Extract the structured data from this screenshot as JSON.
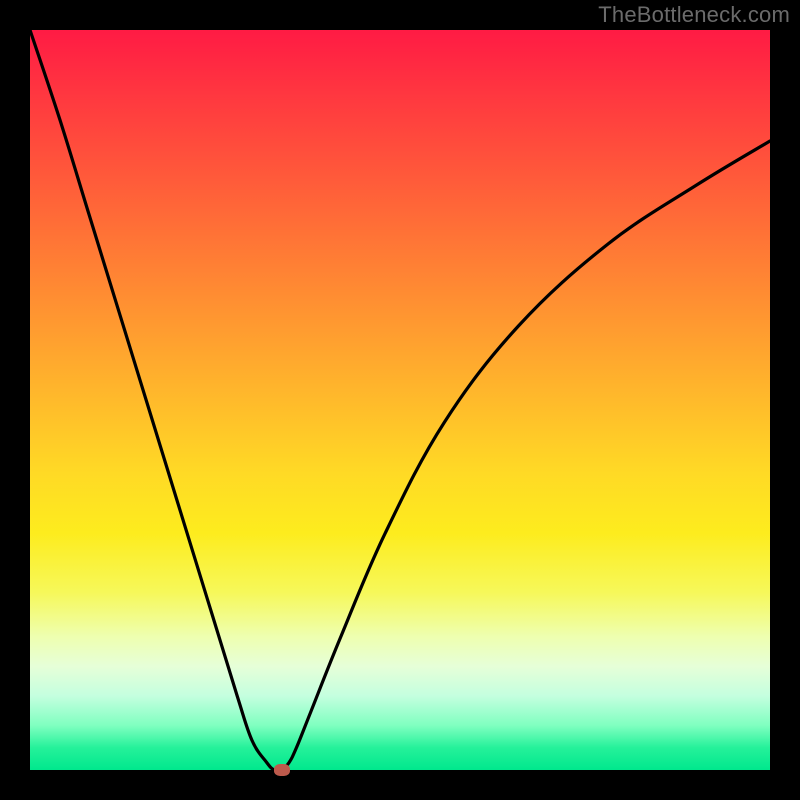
{
  "watermark": "TheBottleneck.com",
  "chart_data": {
    "type": "line",
    "title": "",
    "xlabel": "",
    "ylabel": "",
    "xlim": [
      0,
      100
    ],
    "ylim": [
      0,
      100
    ],
    "grid": false,
    "series": [
      {
        "name": "curve",
        "x": [
          0,
          4,
          8,
          12,
          16,
          20,
          24,
          28,
          30,
          32,
          33,
          34,
          35,
          36,
          38,
          42,
          48,
          56,
          66,
          78,
          90,
          100
        ],
        "values": [
          100,
          88,
          75,
          62,
          49,
          36,
          23,
          10,
          4,
          1,
          0,
          0,
          1,
          3,
          8,
          18,
          32,
          47,
          60,
          71,
          79,
          85
        ]
      }
    ],
    "marker": {
      "x": 34,
      "y": 0
    },
    "colors": {
      "gradient_top": "#ff1b44",
      "gradient_mid": "#ffda25",
      "gradient_bottom": "#00e88d",
      "curve": "#000000",
      "marker": "#bd5a4c",
      "frame": "#000000"
    }
  }
}
